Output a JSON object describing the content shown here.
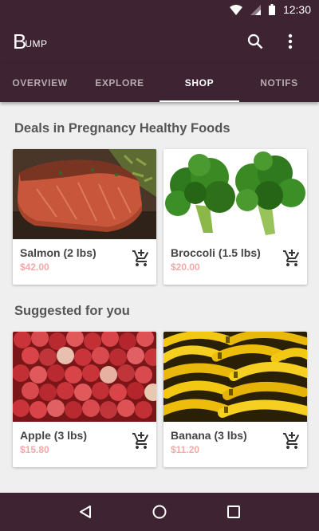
{
  "status_bar": {
    "time": "12:30",
    "icons": [
      "wifi-icon",
      "signal-icon",
      "battery-icon"
    ]
  },
  "app_bar": {
    "logo_big": "B",
    "logo_small": "UMP",
    "actions": [
      "search-icon",
      "more-vert-icon"
    ]
  },
  "tabs": [
    {
      "label": "OVERVIEW",
      "active": false
    },
    {
      "label": "EXPLORE",
      "active": false
    },
    {
      "label": "SHOP",
      "active": true
    },
    {
      "label": "NOTIFS",
      "active": false
    }
  ],
  "sections": [
    {
      "title": "Deals in Pregnancy Healthy Foods",
      "products": [
        {
          "name": "Salmon (2 lbs)",
          "price": "$42.00",
          "image": "salmon"
        },
        {
          "name": "Broccoli (1.5 lbs)",
          "price": "$20.00",
          "image": "broccoli"
        }
      ]
    },
    {
      "title": "Suggested for you",
      "products": [
        {
          "name": "Apple (3 lbs)",
          "price": "$15.80",
          "image": "apples"
        },
        {
          "name": "Banana (3 lbs)",
          "price": "$11.20",
          "image": "bananas"
        }
      ]
    }
  ],
  "nav_bar": {
    "buttons": [
      "back-icon",
      "home-icon",
      "recents-icon"
    ]
  },
  "colors": {
    "primary_dark": "#3e2432",
    "price": "#f4a8a8",
    "background": "#efefef"
  }
}
